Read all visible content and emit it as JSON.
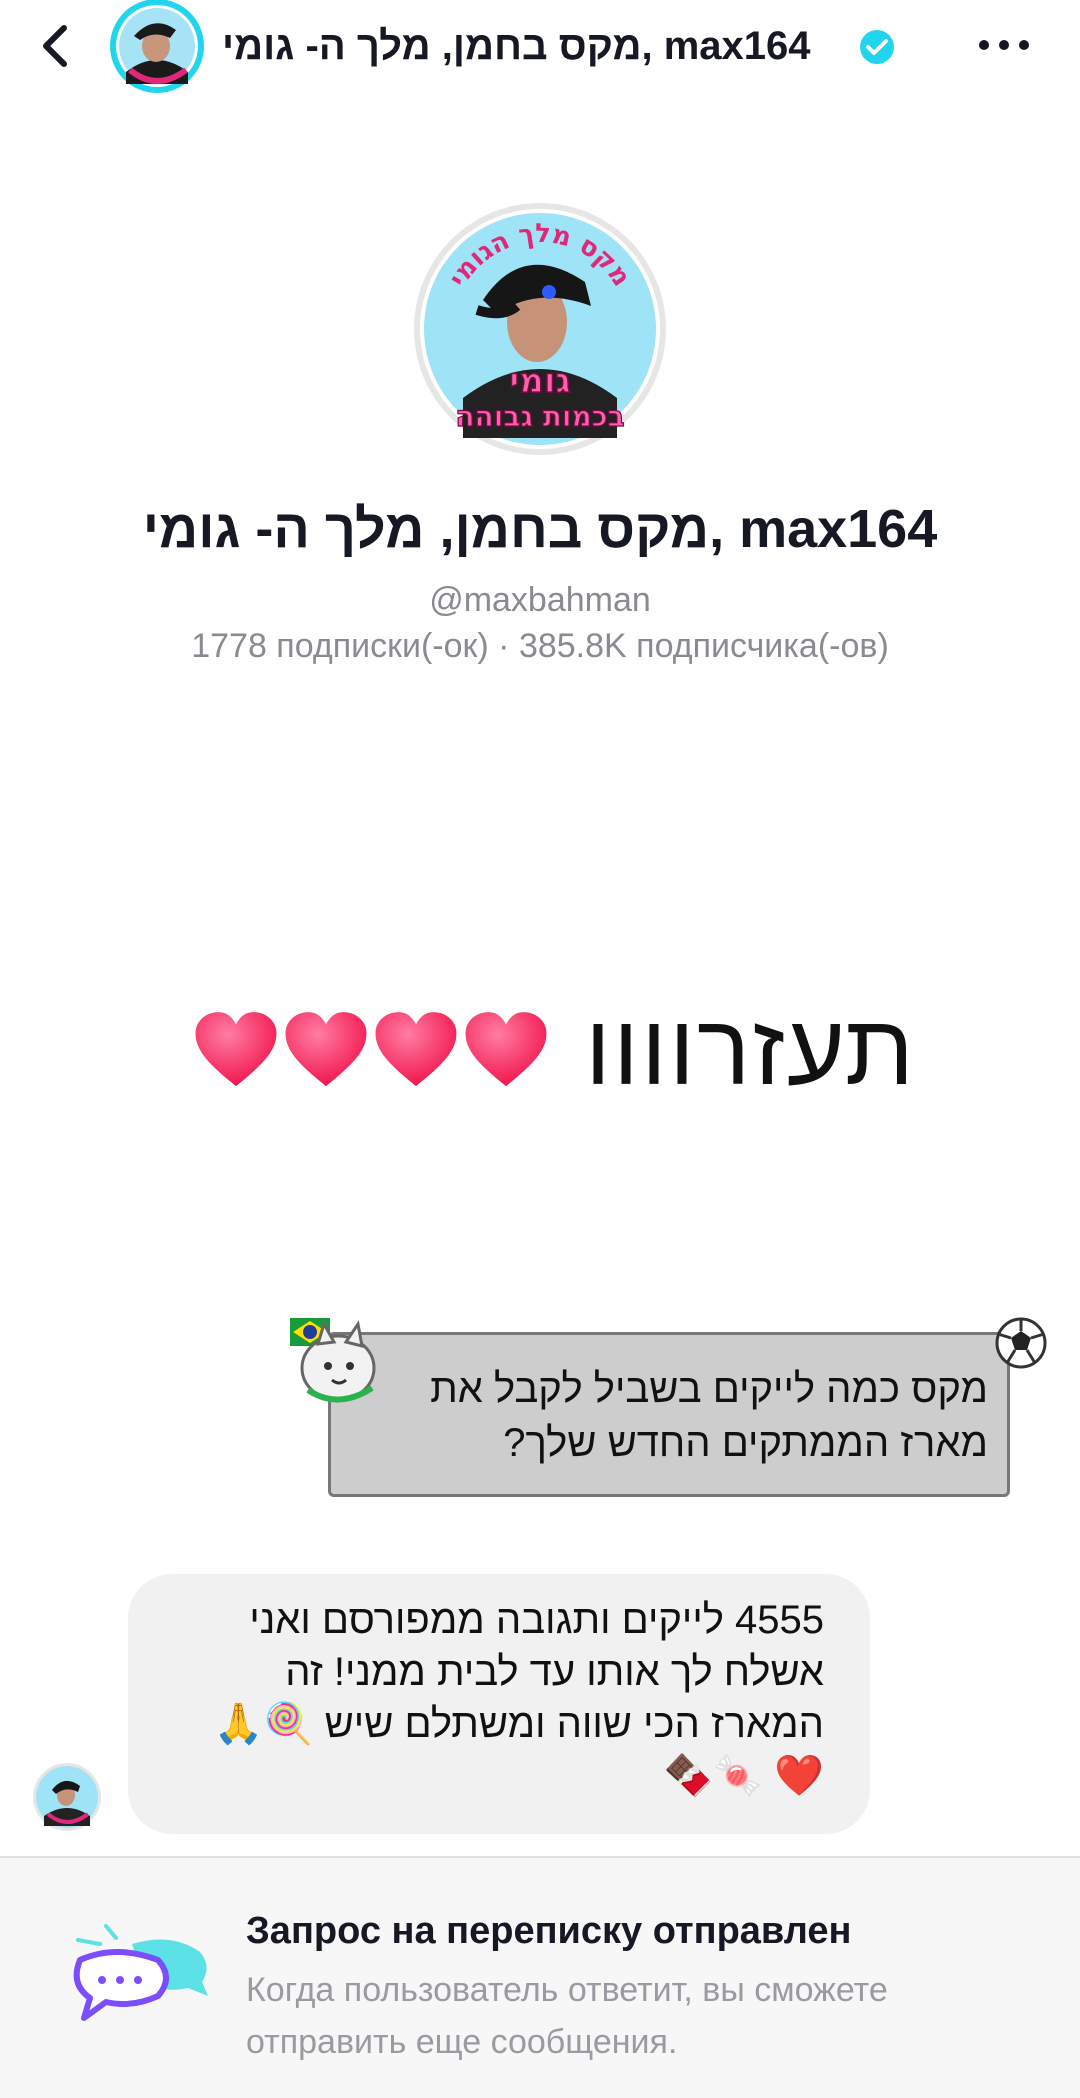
{
  "header": {
    "title": "מקס בחמן, מלך ה- גומי, max164",
    "verified": true,
    "back_icon": "chevron-left-icon",
    "more_icon": "more-horizontal-icon"
  },
  "profile": {
    "avatar_top_text": "מקס מלך הגומי",
    "avatar_bottom_text_1": "גומי",
    "avatar_bottom_text_2": "בכמות גבוהה",
    "name": "מקס בחמן, מלך ה- גומי, max164",
    "handle": "@maxbahman",
    "stats": "1778 подписки(-ок) · 385.8K подписчика(-ов)"
  },
  "video_overlay": {
    "text": "תעזרוווו",
    "hearts": 4
  },
  "quoted_comment": {
    "text": "מקס כמה לייקים בשביל לקבל את מארז הממתקים החדש שלך?",
    "flag": "brazil-flag-icon",
    "ball": "soccer-ball-icon"
  },
  "reply": {
    "text": "4555 לייקים ותגובה ממפורסם ואני אשלח לך אותו עד לבית ממני! זה המארז הכי שווה ומשתלם שיש 🍭🙏❤️ 🍬🍫"
  },
  "footer": {
    "title": "Запрос на переписку отправлен",
    "description": "Когда пользователь ответит, вы сможете отправить еще сообщения."
  },
  "colors": {
    "accent": "#20d5ec",
    "heart": "#ff3b6b",
    "footer_icon_primary": "#7b4dff",
    "footer_icon_secondary": "#5ce1e6"
  }
}
